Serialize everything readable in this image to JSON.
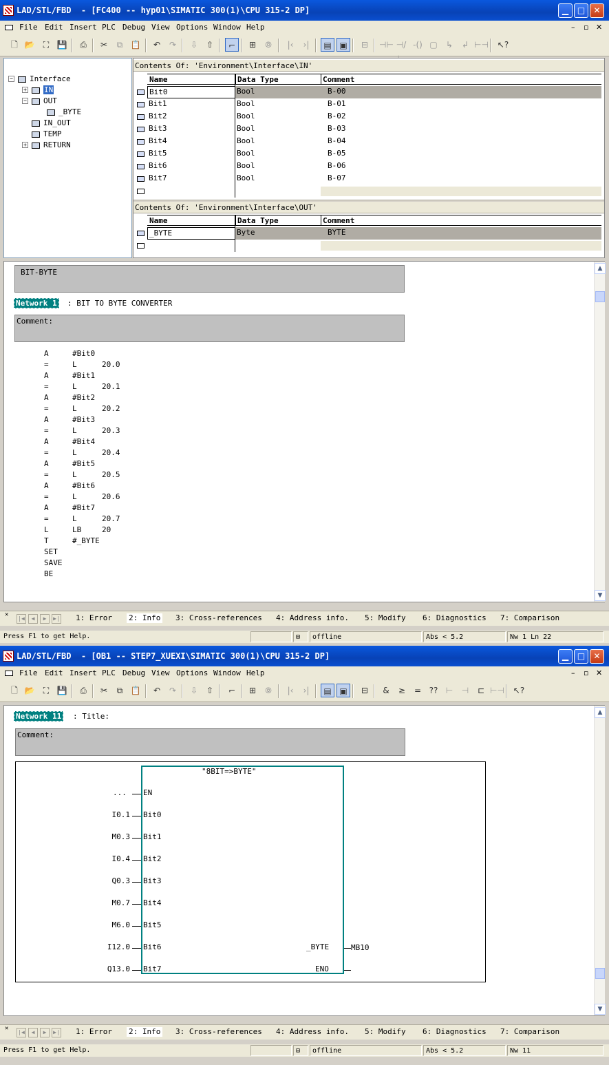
{
  "win1": {
    "title": "LAD/STL/FBD  - [FC400 -- hyp01\\SIMATIC 300(1)\\CPU 315-2 DP]",
    "menu": [
      "File",
      "Edit",
      "Insert",
      "PLC",
      "Debug",
      "View",
      "Options",
      "Window",
      "Help"
    ],
    "tree": {
      "root": "Interface",
      "in": "IN",
      "out": "OUT",
      "out_child": "_BYTE",
      "in_out": "IN_OUT",
      "temp": "TEMP",
      "ret": "RETURN"
    },
    "in_title": "Contents Of: 'Environment\\Interface\\IN'",
    "out_title": "Contents Of: 'Environment\\Interface\\OUT'",
    "headers": {
      "name": "Name",
      "type": "Data Type",
      "comment": "Comment"
    },
    "in_rows": [
      {
        "name": "Bit0",
        "type": "Bool",
        "comment": "B-00"
      },
      {
        "name": "Bit1",
        "type": "Bool",
        "comment": "B-01"
      },
      {
        "name": "Bit2",
        "type": "Bool",
        "comment": "B-02"
      },
      {
        "name": "Bit3",
        "type": "Bool",
        "comment": "B-03"
      },
      {
        "name": "Bit4",
        "type": "Bool",
        "comment": "B-04"
      },
      {
        "name": "Bit5",
        "type": "Bool",
        "comment": "B-05"
      },
      {
        "name": "Bit6",
        "type": "Bool",
        "comment": "B-06"
      },
      {
        "name": "Bit7",
        "type": "Bool",
        "comment": "B-07"
      }
    ],
    "out_rows": [
      {
        "name": "_BYTE",
        "type": "Byte",
        "comment": "BYTE"
      }
    ],
    "block_title": "BIT-BYTE",
    "network_label": "Network 1",
    "network_title": ": BIT TO BYTE CONVERTER",
    "comment_label": "Comment:",
    "stl": [
      [
        "A",
        "#Bit0",
        ""
      ],
      [
        "=",
        "L",
        "20.0"
      ],
      [
        "A",
        "#Bit1",
        ""
      ],
      [
        "=",
        "L",
        "20.1"
      ],
      [
        "A",
        "#Bit2",
        ""
      ],
      [
        "=",
        "L",
        "20.2"
      ],
      [
        "A",
        "#Bit3",
        ""
      ],
      [
        "=",
        "L",
        "20.3"
      ],
      [
        "A",
        "#Bit4",
        ""
      ],
      [
        "=",
        "L",
        "20.4"
      ],
      [
        "A",
        "#Bit5",
        ""
      ],
      [
        "=",
        "L",
        "20.5"
      ],
      [
        "A",
        "#Bit6",
        ""
      ],
      [
        "=",
        "L",
        "20.6"
      ],
      [
        "A",
        "#Bit7",
        ""
      ],
      [
        "=",
        "L",
        "20.7"
      ],
      [
        "L",
        "LB",
        "20"
      ],
      [
        "T",
        "#_BYTE",
        ""
      ],
      [
        "SET",
        "",
        ""
      ],
      [
        "SAVE",
        "",
        ""
      ],
      [
        "BE",
        "",
        ""
      ]
    ],
    "tabs": [
      "1: Error",
      "2: Info",
      "3: Cross-references",
      "4: Address info.",
      "5: Modify",
      "6: Diagnostics",
      "7: Comparison"
    ],
    "status": {
      "help": "Press F1 to get Help.",
      "mode": "offline",
      "abs": "Abs < 5.2",
      "pos": "Nw 1  Ln 22"
    }
  },
  "win2": {
    "title": "LAD/STL/FBD  - [OB1 -- STEP7_XUEXI\\SIMATIC 300(1)\\CPU 315-2 DP]",
    "network_label": "Network 11",
    "network_title": ": Title:",
    "comment_label": "Comment:",
    "block_name": "\"8BIT=>BYTE\"",
    "en_label": "EN",
    "en_value": "...",
    "inputs": [
      {
        "pin": "Bit0",
        "addr": "I0.1"
      },
      {
        "pin": "Bit1",
        "addr": "M0.3"
      },
      {
        "pin": "Bit2",
        "addr": "I0.4"
      },
      {
        "pin": "Bit3",
        "addr": "Q0.3"
      },
      {
        "pin": "Bit4",
        "addr": "M0.7"
      },
      {
        "pin": "Bit5",
        "addr": "M6.0"
      },
      {
        "pin": "Bit6",
        "addr": "I12.0"
      },
      {
        "pin": "Bit7",
        "addr": "Q13.0"
      }
    ],
    "out_pin": "_BYTE",
    "out_addr": "MB10",
    "eno_label": "ENO",
    "status": {
      "help": "Press F1 to get Help.",
      "mode": "offline",
      "abs": "Abs < 5.2",
      "pos": "Nw 11"
    }
  },
  "colors": {
    "titlebar": "#0a4fd0",
    "network_label": "#008080",
    "selection": "#316ac5",
    "grey_box": "#c0c0c0",
    "box_border": "#008080"
  }
}
